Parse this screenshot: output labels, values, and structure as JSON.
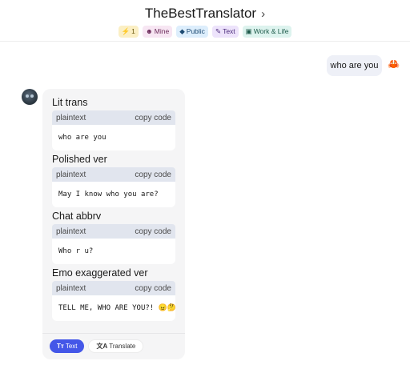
{
  "header": {
    "title": "TheBestTranslator",
    "title_icon": "chevron-right-icon",
    "tags": [
      {
        "icon": "⚡",
        "label": "1",
        "bg": "#fbefc4",
        "color": "#6b5a10"
      },
      {
        "icon": "☻",
        "label": "Mine",
        "bg": "#f7e6f3",
        "color": "#6b2a5a"
      },
      {
        "icon": "◆",
        "label": "Public",
        "bg": "#ddeefc",
        "color": "#1d4a72"
      },
      {
        "icon": "✎",
        "label": "Text",
        "bg": "#ede3fb",
        "color": "#4a2a7a"
      },
      {
        "icon": "▣",
        "label": "Work & Life",
        "bg": "#ddf3ee",
        "color": "#1d5a4a"
      }
    ]
  },
  "conversation": {
    "user_message": "who are you",
    "user_avatar_icon": "🦀",
    "bot_sections": [
      {
        "title": "Lit trans",
        "lang": "plaintext",
        "copy": "copy code",
        "code": "who are you"
      },
      {
        "title": "Polished ver",
        "lang": "plaintext",
        "copy": "copy code",
        "code": "May I know who you are?"
      },
      {
        "title": "Chat abbrv",
        "lang": "plaintext",
        "copy": "copy code",
        "code": "Who r u?"
      },
      {
        "title": "Emo exaggerated ver",
        "lang": "plaintext",
        "copy": "copy code",
        "code": "TELL ME, WHO ARE YOU?! 😠🤔"
      }
    ],
    "actions": {
      "text_icon": "Tт",
      "text_label": "Text",
      "translate_icon": "文A",
      "translate_label": "Translate"
    }
  },
  "colors": {
    "accent": "#4457e8",
    "code_header_bg": "#e1e5ee",
    "bot_bubble_bg": "#f5f5f6",
    "user_bubble_bg": "#eef0f7"
  }
}
